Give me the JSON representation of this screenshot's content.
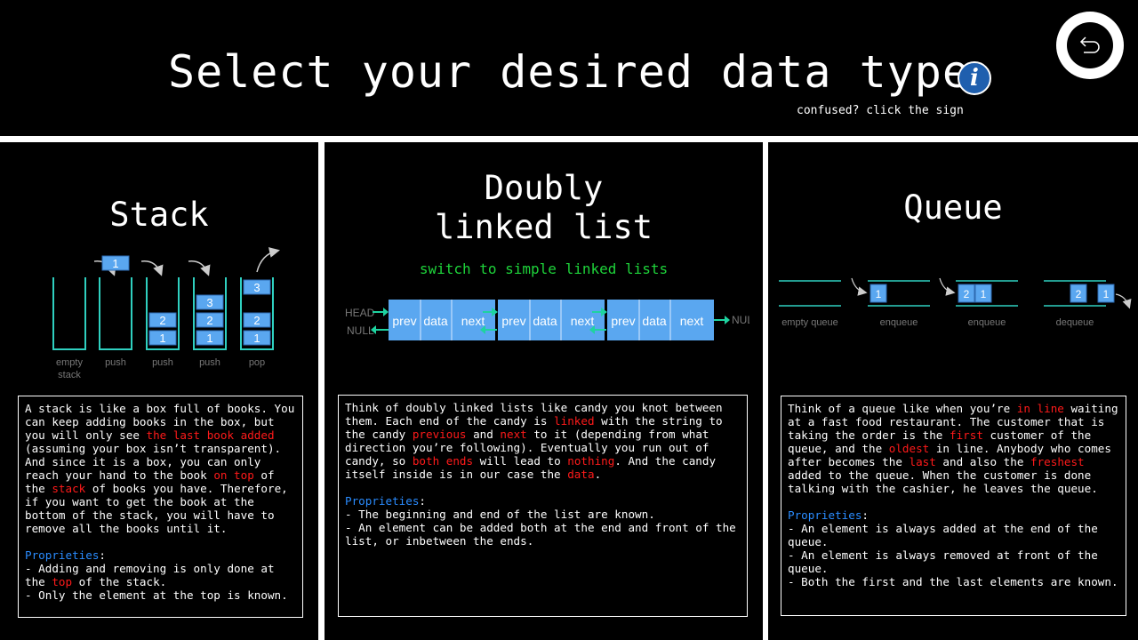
{
  "header": {
    "title": "Select your desired data type",
    "hint": "confused? click the sign",
    "info_symbol": "i",
    "back_icon": "undo-arrow-icon"
  },
  "stack": {
    "title": "Stack",
    "diagram": {
      "labels": [
        "empty",
        "stack",
        "push",
        "push",
        "push",
        "pop"
      ],
      "values": [
        "1",
        "2",
        "1",
        "3",
        "2",
        "1",
        "3",
        "2",
        "1"
      ]
    },
    "desc": {
      "s1": "A stack is like a box full of books. You can keep adding books in the box, but you will only see ",
      "h1": "the last book added",
      "s2": " (assuming your box isn’t transparent). And since it is a box, you can only reach your hand to the book ",
      "h2": "on top",
      "s3": " of the ",
      "h3": "stack",
      "s4": " of books you have. Therefore, if you want to get the book at the bottom of the stack, you will have to remove all the books until it.",
      "prop_label": "Proprieties",
      "colon": ":",
      "l1a": "- Adding and removing is only done at the ",
      "l1h": "top",
      "l1b": " of the stack.",
      "l2": "- Only the element at the top is known."
    }
  },
  "dll": {
    "title1": "Doubly",
    "title2": "linked list",
    "switch_label": "switch to simple linked lists",
    "diagram": {
      "head": "HEAD",
      "null_left": "NULL",
      "null_right": "NULL",
      "cells": [
        "prev",
        "data",
        "next"
      ]
    },
    "desc": {
      "s1": "Think of doubly linked lists like candy you knot between them. Each end of the candy is ",
      "h1": "linked",
      "s2": " with the string to the candy ",
      "h2": "previous",
      "s3": " and ",
      "h3": "next",
      "s4": " to it (depending from what direction you’re following). Eventually you run out of candy, so ",
      "h4": "both ends",
      "s5": " will lead to ",
      "h5": "nothing",
      "s6": ". And the candy itself inside is in our case the ",
      "h6": "data",
      "s7": ".",
      "prop_label": "Proprieties",
      "colon": ":",
      "l1": "- The beginning and end of the list are known.",
      "l2": "- An element can be added both at the end and front of the list, or inbetween the ends."
    }
  },
  "queue": {
    "title": "Queue",
    "diagram": {
      "labels": [
        "empty queue",
        "enqueue",
        "enqueue",
        "dequeue"
      ],
      "values": [
        "1",
        "2",
        "1",
        "2",
        "1"
      ]
    },
    "desc": {
      "s1": "Think of a queue like when you’re ",
      "h1": "in line",
      "s2": " waiting at a fast food restaurant. The customer that is taking the order is the ",
      "h2": "first",
      "s3": " customer of the queue, and the ",
      "h3": "oldest",
      "s4": " in line. Anybody who comes after becomes the ",
      "h4": "last",
      "s5": " and also the ",
      "h5": "freshest",
      "s6": " added to the queue. When the customer is done talking with the cashier, he leaves the queue.",
      "prop_label": "Proprieties",
      "colon": ":",
      "l1": "- An element is always added at the end of the queue.",
      "l2": "- An element is always removed at front of the queue.",
      "l3": "- Both the first and the last elements are known."
    }
  },
  "colors": {
    "background": "#000000",
    "highlight": "#ff1a1a",
    "proprieties": "#2a8cff",
    "switch_link": "#1ed33a",
    "node_fill": "#5aa7f0",
    "teal": "#2fd0c0"
  }
}
